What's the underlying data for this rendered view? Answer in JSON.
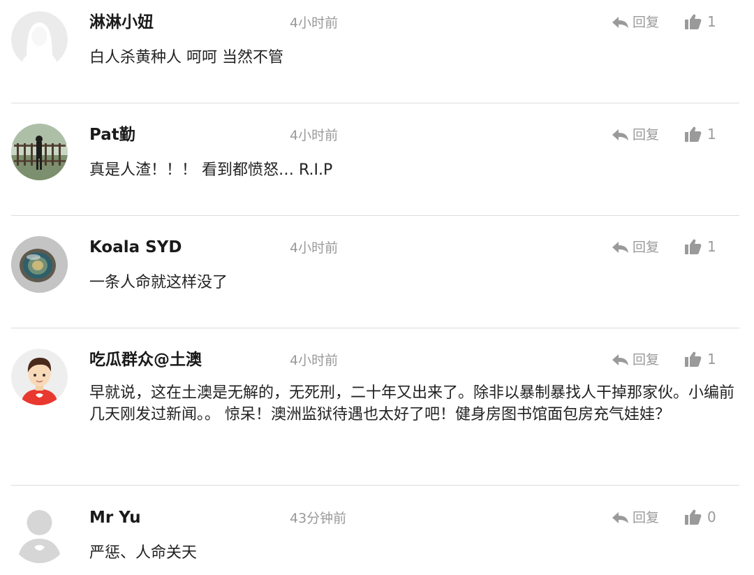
{
  "actions": {
    "reply_label": "回复"
  },
  "comments": [
    {
      "username": "淋淋小妞",
      "time": "4小时前",
      "text": "白人杀黄种人 呵呵 当然不管",
      "likes": "1",
      "avatar": "blank-silhouette"
    },
    {
      "username": "Pat勤",
      "time": "4小时前",
      "text": "真是人渣！！！ 看到都愤怒… R.I.P",
      "likes": "1",
      "avatar": "outdoor-photo"
    },
    {
      "username": "Koala SYD",
      "time": "4小时前",
      "text": "一条人命就这样没了",
      "likes": "1",
      "avatar": "badge-photo"
    },
    {
      "username": "吃瓜群众@土澳",
      "time": "4小时前",
      "text": "早就说，这在土澳是无解的，无死刑，二十年又出来了。除非以暴制暴找人干掉那家伙。小编前几天刚发过新闻。。 惊呆！澳洲监狱待遇也太好了吧！健身房图书馆面包房充气娃娃？",
      "likes": "1",
      "avatar": "cartoon-boy"
    },
    {
      "username": "Mr Yu",
      "time": "43分钟前",
      "text": "严惩、人命关天",
      "likes": "0",
      "avatar": "default-user"
    }
  ],
  "colors": {
    "text": "#222222",
    "muted": "#999999",
    "icon": "#9a9a9a",
    "divider": "#dcdcdc"
  }
}
